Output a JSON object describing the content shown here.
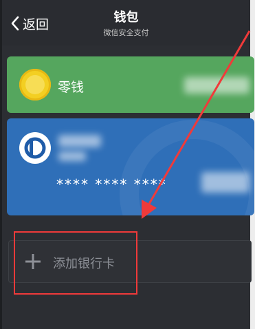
{
  "nav": {
    "back_label": "返回",
    "title": "钱包",
    "subtitle": "微信安全支付"
  },
  "change_card": {
    "label": "零钱"
  },
  "bank_card": {
    "masked_number": "**** **** ****"
  },
  "add_card": {
    "label": "添加银行卡"
  },
  "colors": {
    "nav_bg": "#2a2c31",
    "change_card_bg": "#55a65e",
    "bank_card_bg": "#2f6fb8",
    "annotation_red": "#f03a3a"
  },
  "icons": {
    "back": "chevron-left-icon",
    "change": "coin-icon",
    "bank": "bank-logo-icon",
    "add": "plus-icon"
  }
}
